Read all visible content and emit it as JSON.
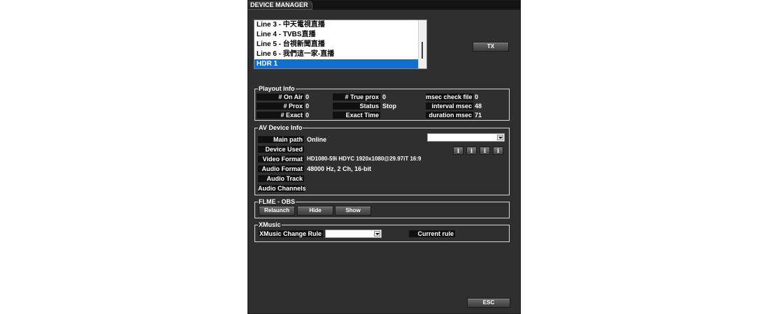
{
  "window": {
    "title": "DEVICE MANAGER"
  },
  "lines": {
    "items": [
      {
        "label": "Line 3 - 中天電視直播",
        "selected": false
      },
      {
        "label": "Line 4 - TVBS直播",
        "selected": false
      },
      {
        "label": "Line 5 - 台視新聞直播",
        "selected": false
      },
      {
        "label": "Line 6 - 我們這一家-直播",
        "selected": false
      },
      {
        "label": "HDR 1",
        "selected": true
      }
    ]
  },
  "tx_button": "TX",
  "playout_info": {
    "title": "Playout Info",
    "col1": [
      {
        "label": "# On Air",
        "value": "0"
      },
      {
        "label": "# Prox",
        "value": "0"
      },
      {
        "label": "# Exact",
        "value": "0"
      }
    ],
    "col2": [
      {
        "label": "# True prox",
        "value": "0"
      },
      {
        "label": "Status",
        "value": "Stop"
      },
      {
        "label": "Exact Time",
        "value": ""
      }
    ],
    "col3": [
      {
        "label": "msec check file",
        "value": "0"
      },
      {
        "label": "interval msec",
        "value": "48"
      },
      {
        "label": "duration msec",
        "value": "71"
      }
    ]
  },
  "av_device_info": {
    "title": "AV Device Info",
    "rows": [
      {
        "label": "Main path",
        "value": "Online"
      },
      {
        "label": "Device Used",
        "value": ""
      },
      {
        "label": "Video Format",
        "value": "HD1080-59i HDYC 1920x1080@29.97iT 16:9"
      },
      {
        "label": "Audio Format",
        "value": "48000 Hz, 2 Ch, 16-bit"
      },
      {
        "label": "Audio Track",
        "value": ""
      },
      {
        "label": "Audio Channels",
        "value": ""
      }
    ],
    "select_value": "",
    "info_buttons": [
      "i",
      "i",
      "i",
      "i"
    ]
  },
  "flme": {
    "title": "FLME - OBS",
    "buttons": {
      "relaunch": "Relaunch",
      "hide": "Hide",
      "show": "Show"
    }
  },
  "xmusic": {
    "title": "XMusic",
    "change_rule_label": "XMusic Change Rule",
    "change_rule_value": "",
    "current_rule_label": "Current rule"
  },
  "esc_button": "ESC",
  "colors": {
    "window_bg": "#2f2f2f",
    "label_bg": "#101010",
    "selection": "#0f6fd1",
    "border": "#d8d8d8"
  }
}
